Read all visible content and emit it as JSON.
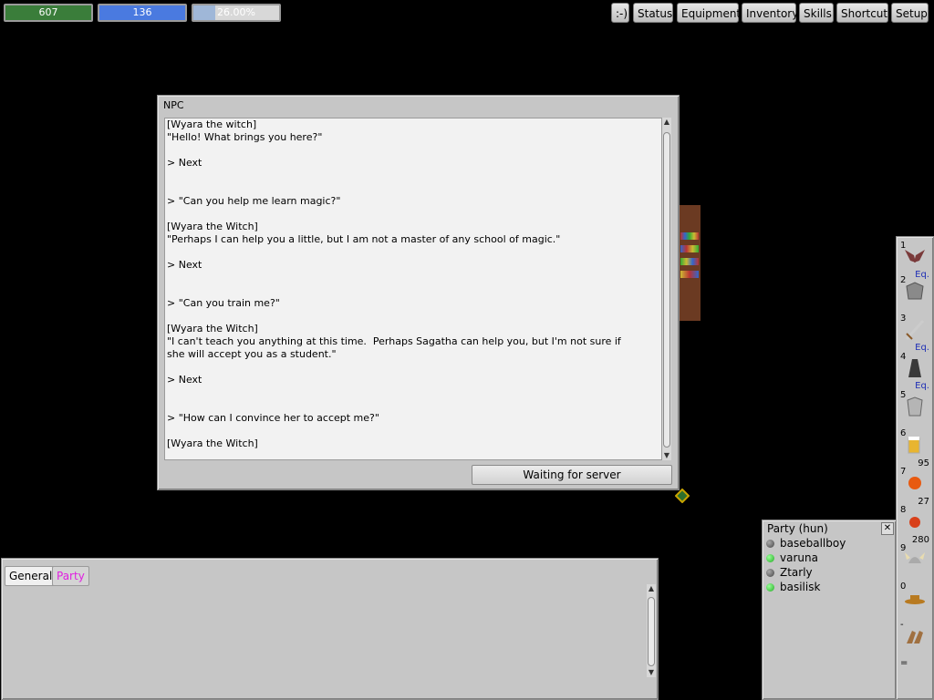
{
  "status_bars": {
    "hp": {
      "value": "607",
      "color": "#3a7d3a"
    },
    "mp": {
      "value": "136",
      "color": "#4a7ae0"
    },
    "xp": {
      "value": "26.00%",
      "fill_percent": 26.0,
      "color": "#9fb7d8"
    }
  },
  "top_menu": [
    ":-)",
    "Status",
    "Equipment",
    "Inventory",
    "Skills",
    "Shortcut",
    "Setup"
  ],
  "npc_window": {
    "title": "NPC",
    "lines": [
      "[Wyara the witch]",
      "\"Hello! What brings you here?\"",
      "",
      "> Next",
      "",
      "",
      "> \"Can you help me learn magic?\"",
      "",
      "[Wyara the Witch]",
      "\"Perhaps I can help you a little, but I am not a master of any school of magic.\"",
      "",
      "> Next",
      "",
      "",
      "> \"Can you train me?\"",
      "",
      "[Wyara the Witch]",
      "\"I can't teach you anything at this time.  Perhaps Sagatha can help you, but I'm not sure if",
      "she will accept you as a student.\"",
      "",
      "> Next",
      "",
      "",
      "> \"How can I convince her to accept me?\"",
      "",
      "[Wyara the Witch]"
    ],
    "button_label": "Waiting for server"
  },
  "chat_window": {
    "tabs": [
      {
        "label": "General",
        "active": true,
        "color": "#000000"
      },
      {
        "label": "Party",
        "active": false,
        "color": "#e020e0"
      }
    ]
  },
  "party_window": {
    "title": "Party (hun)",
    "members": [
      {
        "name": "baseballboy",
        "online": false
      },
      {
        "name": "varuna",
        "online": true
      },
      {
        "name": "Ztarly",
        "online": false
      },
      {
        "name": "basilisk",
        "online": true
      }
    ]
  },
  "shortcut_bar": {
    "slots": [
      {
        "key": "1",
        "icon": "wing-helmet-icon",
        "label": "Eq."
      },
      {
        "key": "2",
        "icon": "armor-chestplate-icon",
        "label": ""
      },
      {
        "key": "3",
        "icon": "sword-icon",
        "label": "Eq."
      },
      {
        "key": "4",
        "icon": "robe-icon",
        "label": "Eq."
      },
      {
        "key": "5",
        "icon": "chainmail-shirt-icon",
        "label": ""
      },
      {
        "key": "6",
        "icon": "beer-mug-icon",
        "label": "95"
      },
      {
        "key": "7",
        "icon": "orange-icon",
        "label": "27"
      },
      {
        "key": "8",
        "icon": "apple-icon",
        "label": "280"
      },
      {
        "key": "9",
        "icon": "viking-helmet-icon",
        "label": ""
      },
      {
        "key": "0",
        "icon": "cowboy-hat-icon",
        "label": ""
      },
      {
        "key": "-",
        "icon": "boots-icon",
        "label": ""
      },
      {
        "key": "=",
        "icon": "empty-slot-icon",
        "label": ""
      }
    ]
  }
}
